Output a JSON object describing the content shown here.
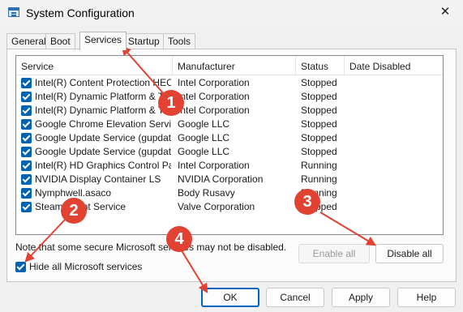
{
  "window": {
    "title": "System Configuration",
    "close_glyph": "✕",
    "icon": "msconfig-icon"
  },
  "tabs": [
    "General",
    "Boot",
    "Services",
    "Startup",
    "Tools"
  ],
  "active_tab": "Services",
  "columns": [
    "Service",
    "Manufacturer",
    "Status",
    "Date Disabled"
  ],
  "services": [
    {
      "name": "Intel(R) Content Protection HEC...",
      "manufacturer": "Intel Corporation",
      "status": "Stopped",
      "date_disabled": "",
      "checked": true
    },
    {
      "name": "Intel(R) Dynamic Platform & The...",
      "manufacturer": "Intel Corporation",
      "status": "Stopped",
      "date_disabled": "",
      "checked": true
    },
    {
      "name": "Intel(R) Dynamic Platform & The...",
      "manufacturer": "Intel Corporation",
      "status": "Stopped",
      "date_disabled": "",
      "checked": true
    },
    {
      "name": "Google Chrome Elevation Servic...",
      "manufacturer": "Google LLC",
      "status": "Stopped",
      "date_disabled": "",
      "checked": true
    },
    {
      "name": "Google Update Service (gupdate)",
      "manufacturer": "Google LLC",
      "status": "Stopped",
      "date_disabled": "",
      "checked": true
    },
    {
      "name": "Google Update Service (gupdatem)",
      "manufacturer": "Google LLC",
      "status": "Stopped",
      "date_disabled": "",
      "checked": true
    },
    {
      "name": "Intel(R) HD Graphics Control Pa...",
      "manufacturer": "Intel Corporation",
      "status": "Running",
      "date_disabled": "",
      "checked": true
    },
    {
      "name": "NVIDIA Display Container LS",
      "manufacturer": "NVIDIA Corporation",
      "status": "Running",
      "date_disabled": "",
      "checked": true
    },
    {
      "name": "Nymphwell.asaco",
      "manufacturer": "Body Rusavy",
      "status": "Running",
      "date_disabled": "",
      "checked": true
    },
    {
      "name": "Steam Client Service",
      "manufacturer": "Valve Corporation",
      "status": "Stopped",
      "date_disabled": "",
      "checked": true
    }
  ],
  "note": "Note that some secure Microsoft services may not be disabled.",
  "hide_ms": {
    "label": "Hide all Microsoft services",
    "checked": true
  },
  "buttons": {
    "enable_all": "Enable all",
    "disable_all": "Disable all",
    "ok": "OK",
    "cancel": "Cancel",
    "apply": "Apply",
    "help": "Help"
  },
  "annotations": {
    "badges": [
      "1",
      "2",
      "3",
      "4"
    ],
    "color": "#e24232"
  },
  "colors": {
    "checkbox": "#0063b1",
    "default_button_border": "#0067c0"
  }
}
